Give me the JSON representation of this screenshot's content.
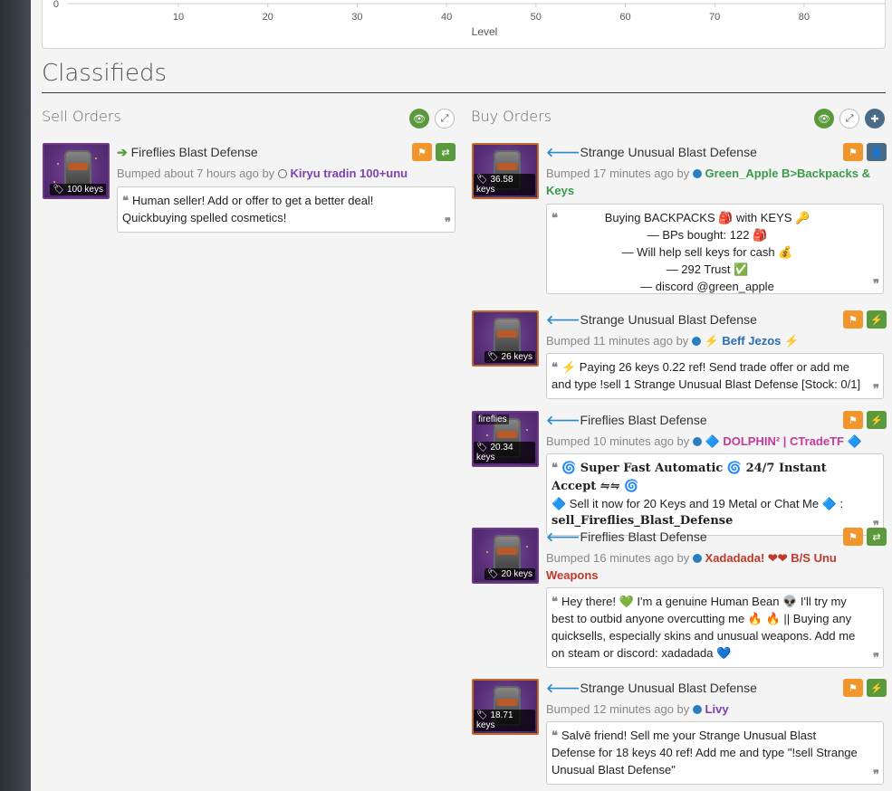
{
  "chart": {
    "y_tick": "0",
    "x_ticks": [
      "10",
      "20",
      "30",
      "40",
      "50",
      "60",
      "70",
      "80"
    ],
    "x_axis_title": "Level"
  },
  "classifieds": {
    "title": "Classifieds"
  },
  "sell": {
    "title": "Sell Orders",
    "listings": [
      {
        "price": "100 keys",
        "name": "Fireflies Blast Defense",
        "bumped": "Bumped about 7 hours ago by",
        "user": "Kiryu tradin 100+unu",
        "message": "Human seller! Add or offer to get a better deal! Quickbuying spelled cosmetics!"
      }
    ]
  },
  "buy": {
    "title": "Buy Orders",
    "listings": [
      {
        "price": "36.58 keys",
        "name": "Strange Unusual Blast Defense",
        "bumped": "Bumped 17 minutes ago by",
        "user": "Green_Apple B>Backpacks & Keys",
        "message_lines": [
          "Buying BACKPACKS 🎒 with KEYS 🔑",
          "— BPs bought: 122 🎒",
          "— Will help sell keys for cash 💰",
          "— 292 Trust ✅",
          "— discord @green_apple"
        ]
      },
      {
        "price": "26 keys",
        "name": "Strange Unusual Blast Defense",
        "bumped": "Bumped 11 minutes ago by",
        "user": "⚡ Beff Jezos ⚡",
        "message": "⚡ Paying 26 keys 0.22 ref! Send trade offer or add me and type !sell 1 Strange Unusual Blast Defense [Stock: 0/1]"
      },
      {
        "price": "20.34 keys",
        "effect": "fireflies",
        "name": "Fireflies Blast Defense",
        "bumped": "Bumped 10 minutes ago by",
        "user": "🔷 DOLPHIN² | CTradeTF 🔷",
        "message_lines": [
          "🌀 Super Fast Automatic 🌀 24/7 Instant Accept ⇋⇋ 🌀",
          "🔷 Sell it now for 20 Keys and 19 Metal or Chat Me 🔷 :",
          "sell_Fireflies_Blast_Defense"
        ]
      },
      {
        "price": "20 keys",
        "name": "Fireflies Blast Defense",
        "bumped": "Bumped 16 minutes ago by",
        "user": "Xadadada! ❤❤ B/S Unu Weapons",
        "message": "Hey there! 💚 I'm a genuine Human Bean 👽 I'll try my best to outbid anyone overcutting me 🔥 🔥 || Buying any quicksells, especially skins and unusual weapons. Add me on steam or discord: xadadada 💙"
      },
      {
        "price": "18.71 keys",
        "name": "Strange Unusual Blast Defense",
        "bumped": "Bumped 12 minutes ago by",
        "user": "Livy",
        "message": "Salvē friend! Sell me your Strange Unusual Blast Defense for 18 keys 40 ref! Add me and type \"!sell Strange Unusual Blast Defense\""
      }
    ]
  },
  "colors": {
    "accent_green": "#5b9a3c",
    "accent_orange": "#f0962c",
    "user_purple": "#7d3fb3",
    "user_green": "#3a9a4a",
    "user_blue": "#2a6db5",
    "user_pink": "#c23a9a",
    "user_red": "#c0392b"
  }
}
